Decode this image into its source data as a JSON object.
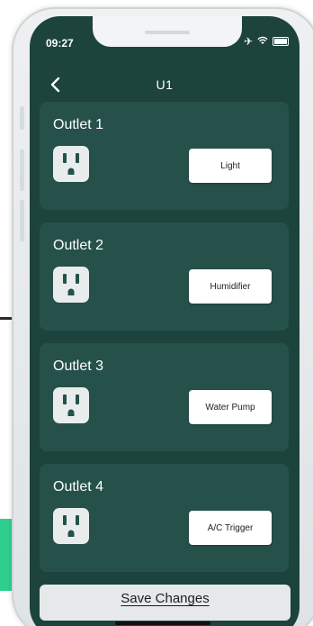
{
  "status_bar": {
    "time": "09:27",
    "icons": [
      "airplane-icon",
      "wifi-icon",
      "battery-icon"
    ]
  },
  "nav": {
    "back_icon": "chevron-left-icon",
    "title": "U1"
  },
  "outlets": [
    {
      "title": "Outlet 1",
      "device": "Light",
      "icon": "power-outlet-icon"
    },
    {
      "title": "Outlet 2",
      "device": "Humidifier",
      "icon": "power-outlet-icon"
    },
    {
      "title": "Outlet 3",
      "device": "Water Pump",
      "icon": "power-outlet-icon"
    },
    {
      "title": "Outlet 4",
      "device": "A/C Trigger",
      "icon": "power-outlet-icon"
    }
  ],
  "save_button": {
    "label": "Save Changes"
  },
  "colors": {
    "screen_bg": "#1d433d",
    "card_bg": "#25514a",
    "button_bg": "#ffffff",
    "save_bg": "#e6e8ea"
  }
}
